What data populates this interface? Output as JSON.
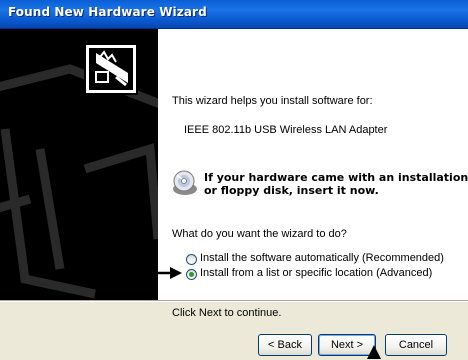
{
  "window": {
    "title": "Found New Hardware Wizard"
  },
  "intro": {
    "text": "This wizard helps you install software for:",
    "device_name": "IEEE 802.11b USB Wireless LAN Adapter"
  },
  "cd_note": {
    "line1": "If your hardware came with an installation CD",
    "line2": "or floppy disk, insert it now."
  },
  "question": "What do you want the wizard to do?",
  "options": [
    {
      "label": "Install the software automatically (Recommended)",
      "selected": false
    },
    {
      "label": "Install from a list or specific location (Advanced)",
      "selected": true
    }
  ],
  "footer_text": "Click Next to continue.",
  "buttons": {
    "back": "< Back",
    "next": "Next >",
    "cancel": "Cancel"
  },
  "icons": {
    "banner": "hardware-card-icon",
    "cd": "cd-disk-icon",
    "pointer_arrow": "arrow-pointer-icon",
    "mouse_cursor": "mouse-cursor-icon"
  },
  "colors": {
    "titlebar": "#0a5ed3",
    "panel_bg": "#000000",
    "dialog_bg": "#ece9d8",
    "radio_dot": "#2d9b2d"
  }
}
